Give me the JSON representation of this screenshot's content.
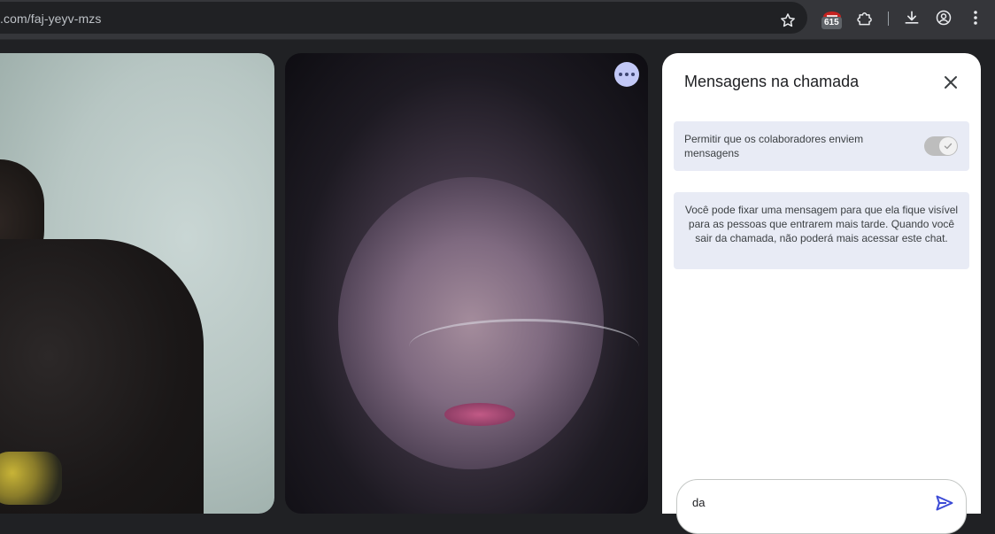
{
  "browser": {
    "url": ".com/faj-yeyv-mzs",
    "extension_badge": "615",
    "icons": [
      "bookmark-star-icon",
      "extension-badge-icon",
      "puzzle-icon",
      "download-icon",
      "profile-icon",
      "kebab-menu-icon"
    ]
  },
  "call": {
    "tiles": [
      "left-participant",
      "center-participant"
    ],
    "more_options_icon": "more-horizontal-icon"
  },
  "chat_panel": {
    "title": "Mensagens na chamada",
    "allow_label": "Permitir que os colaboradores enviem mensagens",
    "allow_enabled": true,
    "info_text": "Você pode fixar uma mensagem para que ela fique visível para as pessoas que entrarem mais tarde. Quando você sair da chamada, não poderá mais acessar este chat.",
    "compose_value": "da"
  },
  "colors": {
    "accent": "#3c4bd6",
    "panel_box": "#e8ebf5",
    "more_button": "#c2c8f6"
  }
}
